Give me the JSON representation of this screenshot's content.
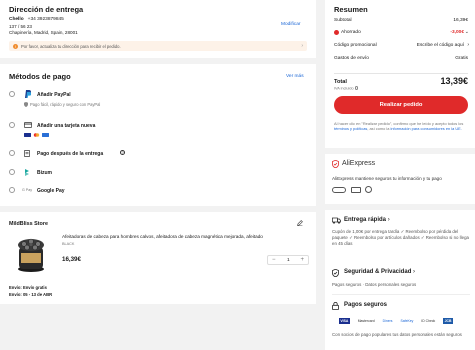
{
  "delivery": {
    "title": "Dirección de entrega",
    "name": "Chello",
    "phone": "+34 3923879845",
    "line1": "137 / 56 23",
    "line2": "Chapinería, Madrid, Spain, 28001",
    "modify_label": "Modificar",
    "warning": "Por favor, actualiza tu dirección para recibir el pedido."
  },
  "payment": {
    "title": "Métodos de pago",
    "see_more": "Ver más",
    "methods": [
      {
        "label": "Añadir PayPal",
        "sub": "Pago fácil, rápido y seguro con PayPal"
      },
      {
        "label": "Añadir una tarjeta nueva",
        "sub": ""
      },
      {
        "label": "Pago después de la entrega",
        "sub": ""
      },
      {
        "label": "Bizum",
        "sub": ""
      },
      {
        "label": "Google Pay",
        "sub": ""
      }
    ],
    "gpay_badge": "G Pay"
  },
  "store": {
    "name": "MildBliss Store",
    "product_title": "Afeitadoras de cabeza para hombres calvos, afeitadora de cabeza magnética mejorada, afeitado",
    "variant": "BLACK",
    "price": "16,39€",
    "quantity": "1",
    "shipping": "Envío: Envío gratis",
    "eta": "Envío: 05 - 13 de ABR"
  },
  "summary": {
    "title": "Resumen",
    "subtotal_label": "Subtotal",
    "subtotal_value": "16,39€",
    "saved_label": "Ahorrado",
    "saved_value": "-3,00€",
    "promo_label": "Código promocional",
    "promo_value": "Escribe el código aquí",
    "shipping_label": "Gastos de envío",
    "shipping_value": "Gratis",
    "total_label": "Total",
    "total_value": "13,39€",
    "vat_note": "IVA incluido",
    "cta": "Realizar pedido",
    "legal_1": "Al hacer clic en \"Realizar pedido\", confirmo que he leído y acepto todos los",
    "legal_link_1": "términos y políticas",
    "legal_2": ", así como la",
    "legal_link_2": "información para consumidores en la UE."
  },
  "trust": {
    "brand": "AliExpress",
    "desc": "AliExpress mantiene seguros tu información y tu pago"
  },
  "benefits": {
    "fast_title": "Entrega rápida",
    "fast_desc": "Cupón de 1,00€ por entrega tardía  ✓ Reembolso por pérdida del paquete  ✓ Reembolso por artículos dañados  ✓ Reembolso si no llega en 45 días",
    "safety_title": "Seguridad & Privacidad",
    "safety_desc": "Pagos seguros · Datos personales seguros",
    "secure_title": "Pagos seguros",
    "secure_desc": "Con socios de pago populares tus datos personales están seguros",
    "partners": [
      "VISA",
      "Mastercard",
      "Diners",
      "SafeKey",
      "ID Check",
      "JCB"
    ]
  }
}
